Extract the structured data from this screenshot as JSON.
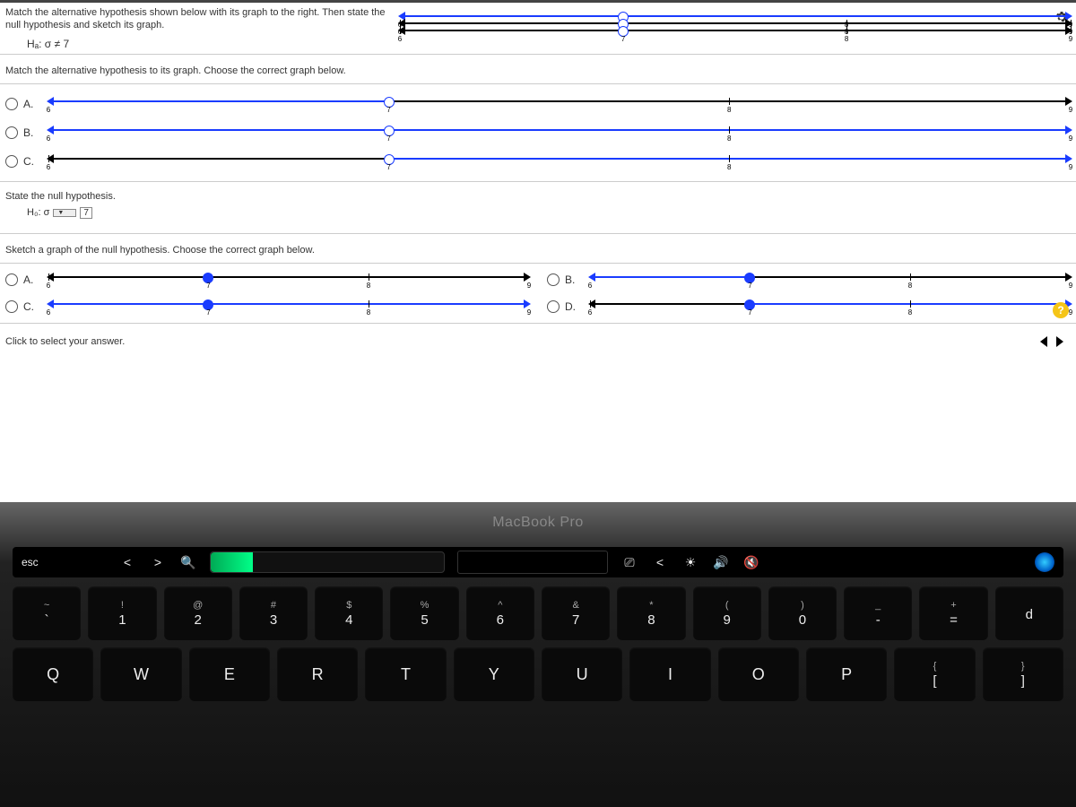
{
  "question": {
    "prompt": "Match the alternative hypothesis shown below with its graph to the right. Then state the null hypothesis and sketch its graph.",
    "hypothesis_label": "Hₐ: σ ≠ 7"
  },
  "ref_graphs": {
    "ticks": [
      "6",
      "7",
      "8",
      "9"
    ],
    "open_at": 7,
    "rows": 3
  },
  "section1": {
    "text": "Match the alternative hypothesis to its graph. Choose the correct graph below."
  },
  "alt_choices": {
    "labels": [
      "A.",
      "B.",
      "C."
    ],
    "ticks": [
      "6",
      "7",
      "8",
      "9"
    ]
  },
  "null_section": {
    "heading": "State the null hypothesis.",
    "lhs": "H₀: σ",
    "dropdown_value": "",
    "value": "7"
  },
  "section2": {
    "text": "Sketch a graph of the null hypothesis. Choose the correct graph below."
  },
  "null_choices": {
    "labels": [
      "A.",
      "B.",
      "C.",
      "D."
    ],
    "ticks": [
      "6",
      "7",
      "8",
      "9"
    ]
  },
  "footer": {
    "text": "Click to select your answer.",
    "help": "?"
  },
  "laptop": {
    "brand": "MacBook Pro",
    "touchbar": {
      "esc": "esc",
      "arrows": [
        "<",
        ">"
      ],
      "search": "🔍",
      "screenshot": "⎚",
      "back": "<",
      "bright": "☀",
      "vol": "🔊",
      "mute": "🔇"
    },
    "rows": [
      [
        {
          "top": "~",
          "bot": "`"
        },
        {
          "top": "!",
          "bot": "1"
        },
        {
          "top": "@",
          "bot": "2"
        },
        {
          "top": "#",
          "bot": "3"
        },
        {
          "top": "$",
          "bot": "4"
        },
        {
          "top": "%",
          "bot": "5"
        },
        {
          "top": "^",
          "bot": "6"
        },
        {
          "top": "&",
          "bot": "7"
        },
        {
          "top": "*",
          "bot": "8"
        },
        {
          "top": "(",
          "bot": "9"
        },
        {
          "top": ")",
          "bot": "0"
        },
        {
          "top": "_",
          "bot": "-"
        },
        {
          "top": "+",
          "bot": "="
        },
        {
          "top": "",
          "bot": "d"
        }
      ],
      [
        {
          "letter": "Q"
        },
        {
          "letter": "W"
        },
        {
          "letter": "E"
        },
        {
          "letter": "R"
        },
        {
          "letter": "T"
        },
        {
          "letter": "Y"
        },
        {
          "letter": "U"
        },
        {
          "letter": "I"
        },
        {
          "letter": "O"
        },
        {
          "letter": "P"
        },
        {
          "top": "{",
          "bot": "["
        },
        {
          "top": "}",
          "bot": "]"
        }
      ]
    ]
  }
}
